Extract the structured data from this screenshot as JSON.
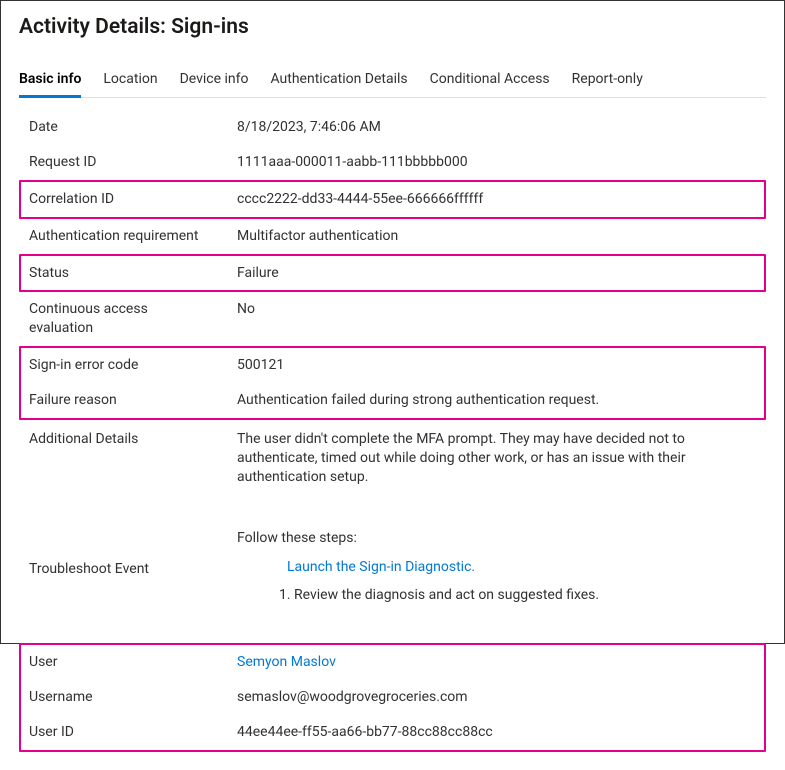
{
  "title": "Activity Details: Sign-ins",
  "tabs": {
    "basic": "Basic info",
    "location": "Location",
    "device": "Device info",
    "auth": "Authentication Details",
    "ca": "Conditional Access",
    "report": "Report-only"
  },
  "fields": {
    "date": {
      "label": "Date",
      "value": "8/18/2023, 7:46:06 AM"
    },
    "request_id": {
      "label": "Request ID",
      "value": "1111aaa-000011-aabb-111bbbbb000"
    },
    "correlation_id": {
      "label": "Correlation ID",
      "value": "cccc2222-dd33-4444-55ee-666666ffffff"
    },
    "auth_req": {
      "label": "Authentication requirement",
      "value": "Multifactor authentication"
    },
    "status": {
      "label": "Status",
      "value": "Failure"
    },
    "cae": {
      "label": "Continuous access evaluation",
      "value": "No"
    },
    "error_code": {
      "label": "Sign-in error code",
      "value": "500121"
    },
    "failure_reason": {
      "label": "Failure reason",
      "value": "Authentication failed during strong authentication request."
    },
    "additional": {
      "label": "Additional Details",
      "value": "The user didn't complete the MFA prompt. They may have decided not to authenticate, timed out while doing other work, or has an issue with their authentication setup."
    },
    "troubleshoot": {
      "label": "Troubleshoot Event",
      "intro": "Follow these steps:",
      "link": "Launch the Sign-in Diagnostic.",
      "step1": "1. Review the diagnosis and act on suggested fixes."
    },
    "user": {
      "label": "User",
      "value": "Semyon Maslov"
    },
    "username": {
      "label": "Username",
      "value": "semaslov@woodgrovegroceries.com"
    },
    "user_id": {
      "label": "User ID",
      "value": "44ee44ee-ff55-aa66-bb77-88cc88cc88cc"
    }
  }
}
